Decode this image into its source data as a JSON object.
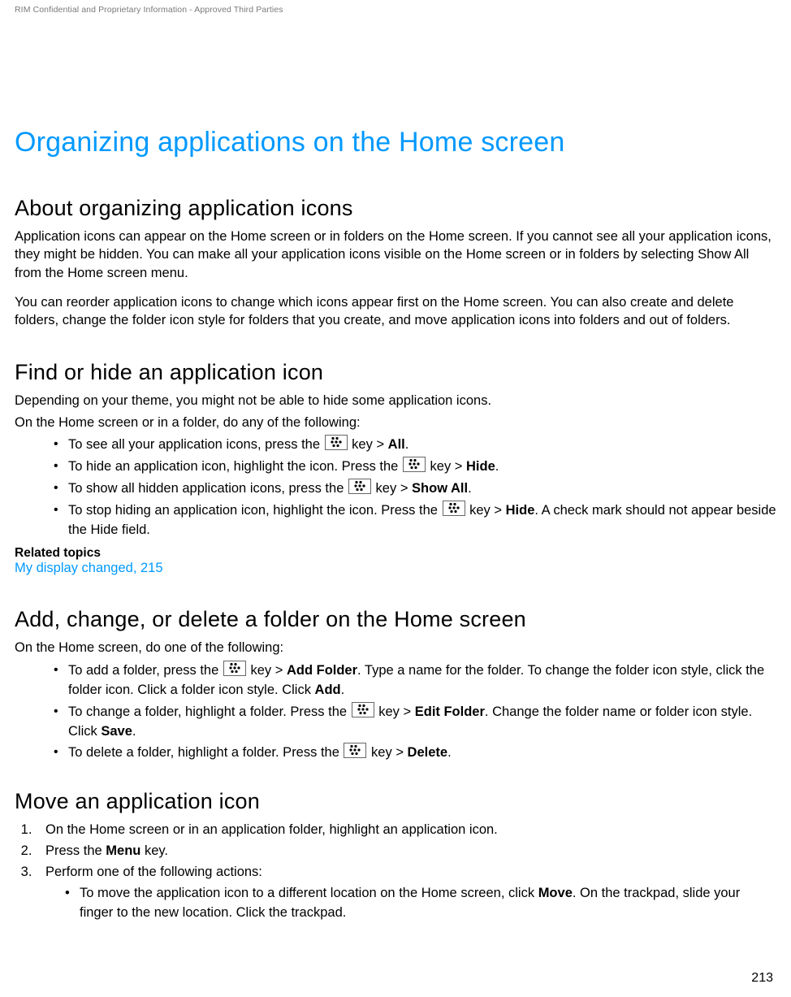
{
  "header": {
    "confidential": "RIM Confidential and Proprietary Information - Approved Third Parties"
  },
  "title": "Organizing applications on the Home screen",
  "sections": {
    "about": {
      "heading": "About organizing application icons",
      "p1": "Application icons can appear on the Home screen or in folders on the Home screen. If you cannot see all your application icons, they might be hidden. You can make all your application icons visible on the Home screen or in folders by selecting Show All from the Home screen menu.",
      "p2": "You can reorder application icons to change which icons appear first on the Home screen. You can also create and delete folders, change the folder icon style for folders that you create, and move application icons into folders and out of folders."
    },
    "find": {
      "heading": "Find or hide an application icon",
      "lead": "Depending on your theme, you might not be able to hide some application icons.",
      "intro": "On the Home screen or in a folder, do any of the following:",
      "items": {
        "i1a": "To see all your application icons, press the ",
        "i1b": " key > ",
        "i1c": "All",
        "i1d": ".",
        "i2a": "To hide an application icon, highlight the icon. Press the ",
        "i2b": " key > ",
        "i2c": "Hide",
        "i2d": ".",
        "i3a": "To show all hidden application icons, press the ",
        "i3b": " key > ",
        "i3c": "Show All",
        "i3d": ".",
        "i4a": "To stop hiding an application icon, highlight the icon. Press the ",
        "i4b": " key > ",
        "i4c": "Hide",
        "i4d": ". A check mark should not appear beside the Hide field."
      },
      "related_label": "Related topics",
      "related_link": "My display changed, 215"
    },
    "folder": {
      "heading": "Add, change, or delete a folder on the Home screen",
      "intro": "On the Home screen, do one of the following:",
      "items": {
        "i1a": "To add a folder, press the ",
        "i1b": " key > ",
        "i1c": "Add Folder",
        "i1d": ". Type a name for the folder. To change the folder icon style, click the folder icon. Click a folder icon style. Click ",
        "i1e": "Add",
        "i1f": ".",
        "i2a": "To change a folder, highlight a folder. Press the ",
        "i2b": " key > ",
        "i2c": "Edit Folder",
        "i2d": ". Change the folder name or folder icon style. Click ",
        "i2e": "Save",
        "i2f": ".",
        "i3a": "To delete a folder, highlight a folder. Press the ",
        "i3b": " key > ",
        "i3c": "Delete",
        "i3d": "."
      }
    },
    "move": {
      "heading": "Move an application icon",
      "steps": {
        "s1": "On the Home screen or in an application folder, highlight an application icon.",
        "s2a": "Press the ",
        "s2b": "Menu",
        "s2c": " key.",
        "s3": "Perform one of the following actions:",
        "sub1a": "To move the application icon to a different location on the Home screen, click ",
        "sub1b": "Move",
        "sub1c": ". On the trackpad, slide your finger to the new location. Click the trackpad."
      }
    }
  },
  "page_number": "213"
}
